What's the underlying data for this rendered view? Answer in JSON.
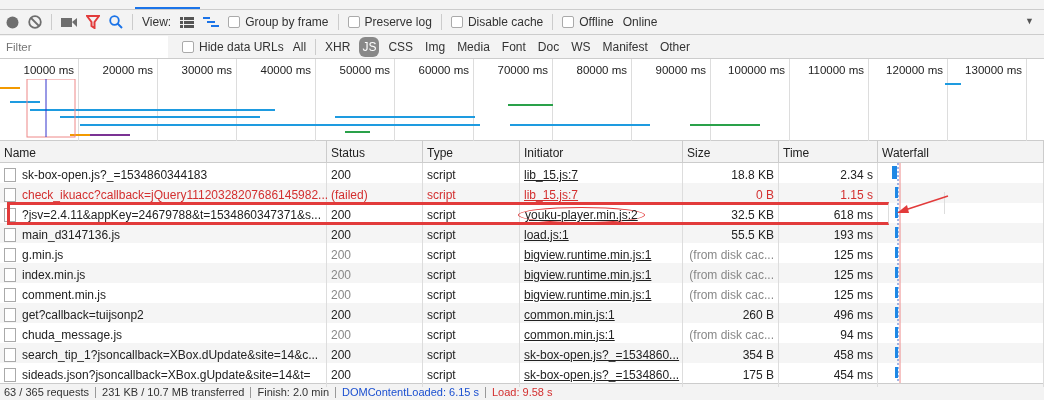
{
  "toolbar": {
    "record_on": false,
    "filter_active": true,
    "search_active": true,
    "view_label": "View:",
    "large_rows": false,
    "overview": true,
    "checkboxes": [
      {
        "label": "Group by frame",
        "checked": false
      },
      {
        "label": "Preserve log",
        "checked": false
      },
      {
        "label": "Disable cache",
        "checked": false
      },
      {
        "label": "Offline",
        "checked": false
      }
    ],
    "throttling": "Online",
    "menu_caret": "▼"
  },
  "filter_bar": {
    "placeholder": "Filter",
    "hide_data_urls": {
      "label": "Hide data URLs",
      "checked": false
    },
    "types": [
      {
        "label": "All",
        "selected": false
      },
      {
        "label": "XHR",
        "selected": false
      },
      {
        "label": "JS",
        "selected": true
      },
      {
        "label": "CSS",
        "selected": false
      },
      {
        "label": "Img",
        "selected": false
      },
      {
        "label": "Media",
        "selected": false
      },
      {
        "label": "Font",
        "selected": false
      },
      {
        "label": "Doc",
        "selected": false
      },
      {
        "label": "WS",
        "selected": false
      },
      {
        "label": "Manifest",
        "selected": false
      },
      {
        "label": "Other",
        "selected": false
      }
    ]
  },
  "overview": {
    "ticks": [
      "10000 ms",
      "20000 ms",
      "30000 ms",
      "40000 ms",
      "50000 ms",
      "60000 ms",
      "70000 ms",
      "80000 ms",
      "90000 ms",
      "100000 ms",
      "110000 ms",
      "120000 ms",
      "130000 ms"
    ]
  },
  "table": {
    "columns": [
      "Name",
      "Status",
      "Type",
      "Initiator",
      "Size",
      "Time",
      "Waterfall"
    ],
    "rows": [
      {
        "name": "sk-box-open.js?_=1534860344183",
        "status": "200",
        "type": "script",
        "initiator": "lib_15.js:7",
        "size": "18.8 KB",
        "time": "2.34 s",
        "failed": false,
        "cached": false,
        "highlighted": false,
        "circled": false
      },
      {
        "name": "check_ikuacc?callback=jQuery11120328207686145982...",
        "status": "(failed)",
        "type": "script",
        "initiator": "lib_15.js:7",
        "size": "0 B",
        "time": "1.15 s",
        "failed": true,
        "cached": false,
        "highlighted": false,
        "circled": false
      },
      {
        "name": "?jsv=2.4.11&appKey=24679788&t=1534860347371&s...",
        "status": "200",
        "type": "script",
        "initiator": "youku-player.min.js:2",
        "size": "32.5 KB",
        "time": "618 ms",
        "failed": false,
        "cached": false,
        "highlighted": true,
        "circled": true
      },
      {
        "name": "main_d3147136.js",
        "status": "200",
        "type": "script",
        "initiator": "load.js:1",
        "size": "55.5 KB",
        "time": "193 ms",
        "failed": false,
        "cached": false,
        "highlighted": false,
        "circled": false
      },
      {
        "name": "g.min.js",
        "status": "200",
        "type": "script",
        "initiator": "bigview.runtime.min.js:1",
        "size": "(from disk cac...",
        "time": "125 ms",
        "failed": false,
        "cached": true,
        "highlighted": false,
        "circled": false
      },
      {
        "name": "index.min.js",
        "status": "200",
        "type": "script",
        "initiator": "bigview.runtime.min.js:1",
        "size": "(from disk cac...",
        "time": "125 ms",
        "failed": false,
        "cached": true,
        "highlighted": false,
        "circled": false
      },
      {
        "name": "comment.min.js",
        "status": "200",
        "type": "script",
        "initiator": "bigview.runtime.min.js:1",
        "size": "(from disk cac...",
        "time": "125 ms",
        "failed": false,
        "cached": true,
        "highlighted": false,
        "circled": false
      },
      {
        "name": "get?callback=tuijsonp2",
        "status": "200",
        "type": "script",
        "initiator": "common.min.js:1",
        "size": "260 B",
        "time": "496 ms",
        "failed": false,
        "cached": false,
        "highlighted": false,
        "circled": false
      },
      {
        "name": "chuda_message.js",
        "status": "200",
        "type": "script",
        "initiator": "common.min.js:1",
        "size": "(from disk cac...",
        "time": "94 ms",
        "failed": false,
        "cached": true,
        "highlighted": false,
        "circled": false
      },
      {
        "name": "search_tip_1?jsoncallback=XBox.dUpdate&site=14&c...",
        "status": "200",
        "type": "script",
        "initiator": "sk-box-open.js?_=1534860...",
        "size": "354 B",
        "time": "458 ms",
        "failed": false,
        "cached": false,
        "highlighted": false,
        "circled": false
      },
      {
        "name": "sideads.json?jsoncallback=XBox.gUpdate&site=14&t=",
        "status": "200",
        "type": "script",
        "initiator": "sk-box-open.js?_=1534860...",
        "size": "175 B",
        "time": "454 ms",
        "failed": false,
        "cached": false,
        "highlighted": false,
        "circled": false
      }
    ]
  },
  "status_bar": [
    {
      "text": "63 / 365 requests",
      "kind": "plain"
    },
    {
      "text": "231 KB / 10.7 MB transferred",
      "kind": "plain"
    },
    {
      "text": "Finish: 2.0 min",
      "kind": "plain"
    },
    {
      "text": "DOMContentLoaded: 6.15 s",
      "kind": "dom"
    },
    {
      "text": "Load: 9.58 s",
      "kind": "load"
    }
  ]
}
